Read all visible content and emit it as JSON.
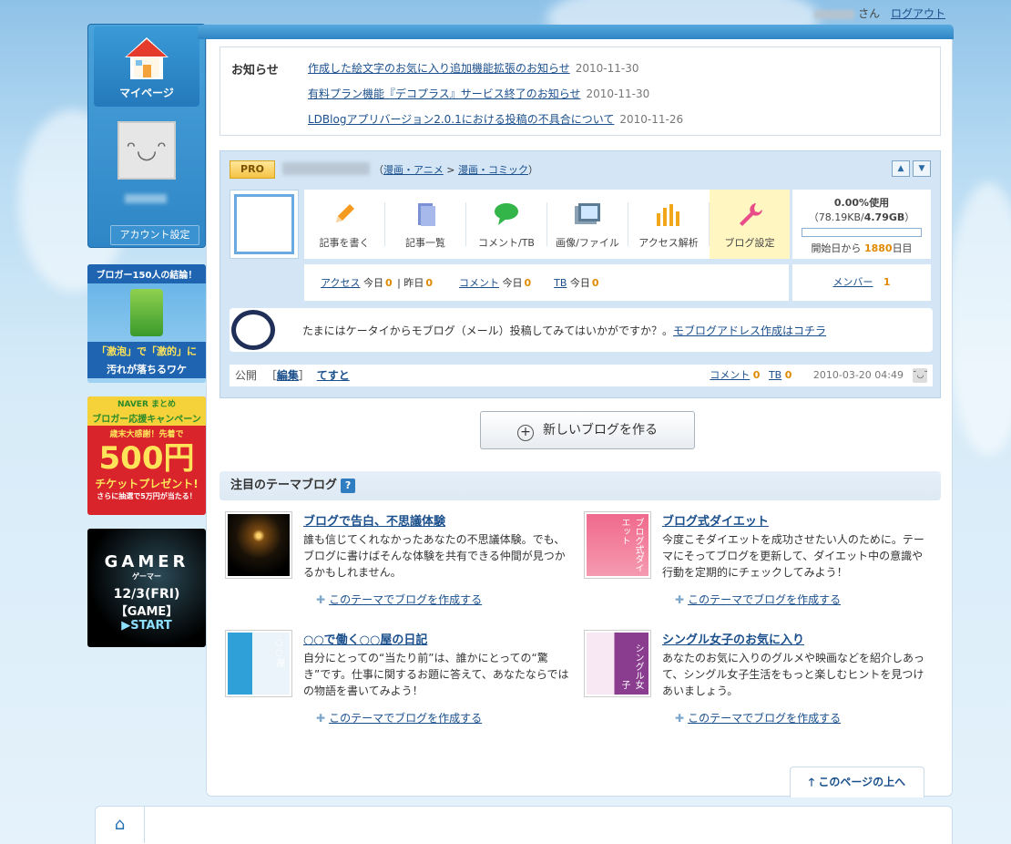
{
  "topbar": {
    "suffix": "さん",
    "logout": "ログアウト"
  },
  "sidebar": {
    "mypage": "マイページ",
    "account": "アカウント設定"
  },
  "ads": [
    {
      "line1": "ブロガー150人の結論！",
      "line2": "「激泡」で「激的」に",
      "line3": "汚れが落ちるワケ"
    },
    {
      "line1": "NAVER まとめ",
      "line2": "ブロガー応援キャンペーン",
      "line3": "歳末大感謝！先着で",
      "big": "500円",
      "line4": "チケットプレゼント!",
      "line5": "さらに抽選で5万円が当たる！"
    },
    {
      "line1": "GAMER",
      "line2": "ゲーマー",
      "line3": "12/3(FRI)",
      "line4": "【GAME】",
      "line5": "▶START"
    }
  ],
  "news": {
    "heading": "お知らせ",
    "items": [
      {
        "title": "作成した絵文字のお気に入り追加機能拡張のお知らせ",
        "date": "2010-11-30"
      },
      {
        "title": "有料プラン機能『デコプラス』サービス終了のお知らせ",
        "date": "2010-11-30"
      },
      {
        "title": "LDBlogアプリバージョン2.0.1における投稿の不具合について",
        "date": "2010-11-26"
      }
    ]
  },
  "blog": {
    "badge": "PRO",
    "category_open": "（",
    "category1": "漫画・アニメ",
    "category_sep": " > ",
    "category2": "漫画・コミック",
    "category_close": "）",
    "up": "▲",
    "down": "▼",
    "tools": [
      "記事を書く",
      "記事一覧",
      "コメント/TB",
      "画像/ファイル",
      "アクセス解析",
      "ブログ設定"
    ],
    "usage": {
      "percent_label": "0.00%使用",
      "detail_open": "（78.19KB/",
      "detail_total": "4.79GB",
      "detail_close": "）",
      "days_prefix": "開始日から",
      "days": "1880",
      "days_suffix": "日目",
      "fill": 0.0
    },
    "stats": {
      "access": "アクセス",
      "today": "今日",
      "today_val": "0",
      "sep": "|",
      "yesterday": "昨日",
      "yesterday_val": "0",
      "comment": "コメント",
      "c_today": "今日",
      "c_val": "0",
      "tb": "TB",
      "tb_today": "今日",
      "tb_val": "0"
    },
    "member": {
      "label": "メンバー",
      "count": "1"
    },
    "tip": {
      "text": "たまにはケータイからモブログ（メール）投稿してみてはいかがですか？。",
      "link": "モブログアドレス作成はコチラ"
    },
    "status": {
      "state": "公開",
      "edit_open": "［",
      "edit": "編集",
      "edit_close": "］",
      "title": "てすと",
      "comment": "コメント",
      "comment_count": "0",
      "tb": "TB",
      "tb_count": "0",
      "datetime": "2010-03-20 04:49"
    }
  },
  "new_blog": "新しいブログを作る",
  "themes": {
    "heading": "注目のテーマブログ",
    "help": "?",
    "make_label": "このテーマでブログを作成する",
    "items": [
      {
        "title": "ブログで告白、不思議体験",
        "desc": "誰も信じてくれなかったあなたの不思議体験。でも、ブログに書けばそんな体験を共有できる仲間が見つかるかもしれません。",
        "pic_text": ""
      },
      {
        "title": "ブログ式ダイエット",
        "desc": "今度こそダイエットを成功させたい人のために。テーマにそってブログを更新して、ダイエット中の意識や行動を定期的にチェックしてみよう！",
        "pic_text": "ブログ式ダイエット"
      },
      {
        "title": "○○で働く○○屋の日記",
        "desc": "自分にとっての“当たり前”は、誰かにとっての“驚き”です。仕事に関するお題に答えて、あなたならではの物語を書いてみよう！",
        "pic_text": "○○屋"
      },
      {
        "title": "シングル女子のお気に入り",
        "desc": "あなたのお気に入りのグルメや映画などを紹介しあって、シングル女子生活をもっと楽しむヒントを見つけあいましょう。",
        "pic_text": "シングル女子"
      }
    ]
  },
  "pagetop": "このページの上へ",
  "colors": {
    "accent": "#2f86c6",
    "link": "#1a4f8c",
    "highlight": "#e08a00"
  }
}
